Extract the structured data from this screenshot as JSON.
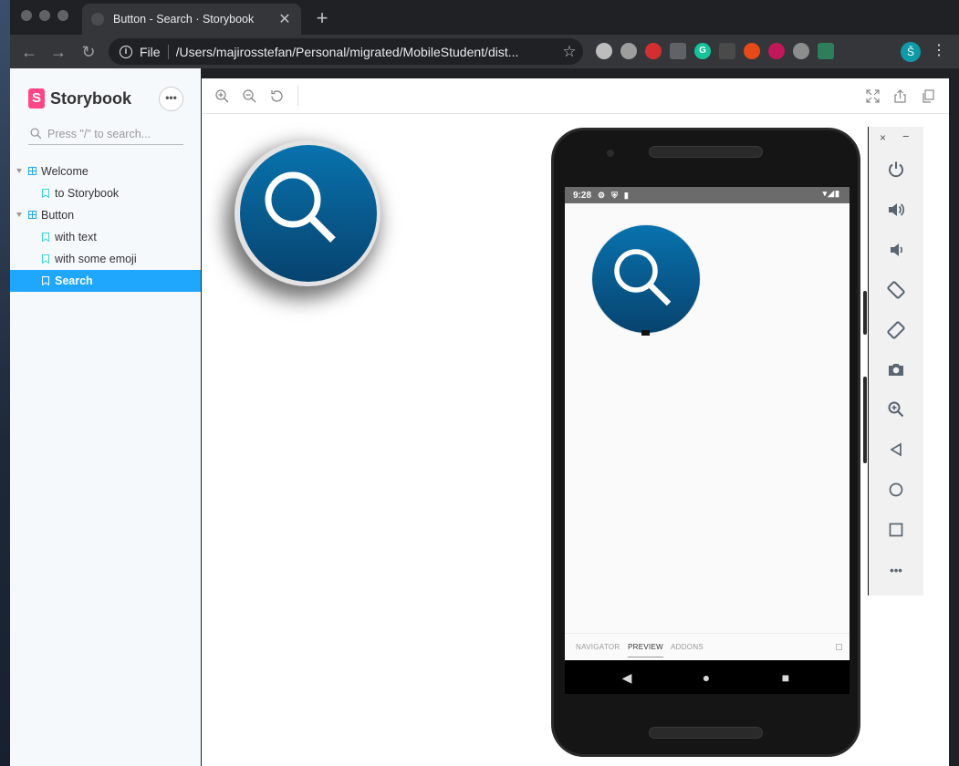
{
  "browser": {
    "tab_title": "Button - Search · Storybook",
    "scheme": "File",
    "url": "/Users/majirosstefan/Personal/migrated/MobileStudent/dist...",
    "profile_initial": "Š"
  },
  "sidebar": {
    "brand": "Storybook",
    "more": "•••",
    "search_placeholder": "Press \"/\" to search...",
    "tree": [
      {
        "type": "group",
        "label": "Welcome"
      },
      {
        "type": "story",
        "label": "to Storybook"
      },
      {
        "type": "group",
        "label": "Button"
      },
      {
        "type": "story",
        "label": "with text"
      },
      {
        "type": "story",
        "label": "with some emoji"
      },
      {
        "type": "story",
        "label": "Search",
        "active": true
      }
    ]
  },
  "device": {
    "time": "9:28",
    "tabs": [
      "NAVIGATOR",
      "PREVIEW",
      "ADDONS"
    ],
    "active_tab": "PREVIEW"
  },
  "emulator": {
    "close": "×",
    "minimize": "−",
    "more": "•••"
  },
  "colors": {
    "accent": "#1ea7fd",
    "storybook_pink": "#ff4785",
    "button_top": "#0872ad",
    "button_bottom": "#07436f"
  }
}
